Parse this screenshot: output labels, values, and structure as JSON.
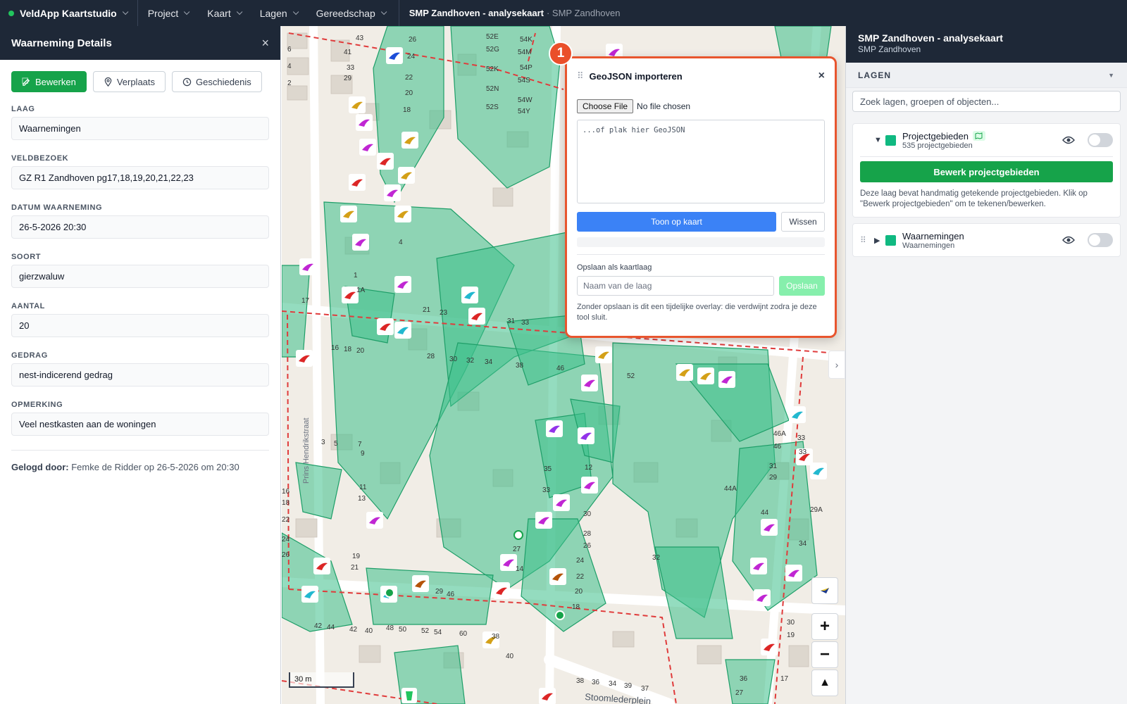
{
  "topbar": {
    "brand": "VeldApp Kaartstudio",
    "menu": [
      "Project",
      "Kaart",
      "Lagen",
      "Gereedschap"
    ],
    "breadcrumb_title": "SMP Zandhoven - analysekaart",
    "breadcrumb_sub": "· SMP Zandhoven"
  },
  "left": {
    "title": "Waarneming Details",
    "close": "×",
    "buttons": {
      "edit": "Bewerken",
      "move": "Verplaats",
      "history": "Geschiedenis"
    },
    "fields": [
      {
        "label": "LAAG",
        "value": "Waarnemingen"
      },
      {
        "label": "VELDBEZOEK",
        "value": "GZ R1 Zandhoven pg17,18,19,20,21,22,23"
      },
      {
        "label": "DATUM WAARNEMING",
        "value": "26-5-2026 20:30"
      },
      {
        "label": "SOORT",
        "value": "gierzwaluw"
      },
      {
        "label": "AANTAL",
        "value": "20"
      },
      {
        "label": "GEDRAG",
        "value": "nest-indicerend gedrag"
      },
      {
        "label": "OPMERKING",
        "value": "Veel nestkasten aan de woningen"
      }
    ],
    "logged_label": "Gelogd door:",
    "logged_value": "Femke de Ridder op 26-5-2026 om 20:30"
  },
  "dialog": {
    "badge": "1",
    "title": "GeoJSON importeren",
    "close": "×",
    "choose_file": "Choose File",
    "no_file": "No file chosen",
    "textarea_placeholder": "...of plak hier GeoJSON",
    "show_btn": "Toon op kaart",
    "clear_btn": "Wissen",
    "save_label": "Opslaan als kaartlaag",
    "layer_name_placeholder": "Naam van de laag",
    "save_btn": "Opslaan",
    "note": "Zonder opslaan is dit een tijdelijke overlay: die verdwijnt zodra je deze tool sluit."
  },
  "map": {
    "scale": "30 m",
    "street_1": "Prins Hendrikstraat",
    "street_2": "Stoomlederplein",
    "house_numbers": [
      "43",
      "26",
      "52E",
      "54K",
      "6",
      "41",
      "24",
      "52G",
      "54M",
      "4",
      "33",
      "52K",
      "54P",
      "2",
      "29",
      "22",
      "54S",
      "20",
      "52N",
      "52S",
      "54W",
      "54Y",
      "18",
      "1A",
      "17",
      "21",
      "23",
      "31",
      "33",
      "16",
      "18",
      "20",
      "28",
      "30",
      "32",
      "34",
      "38",
      "46",
      "52",
      "4",
      "1",
      "3",
      "5",
      "7",
      "9",
      "11",
      "13",
      "19",
      "21",
      "35",
      "33",
      "30",
      "28",
      "26",
      "24",
      "22",
      "20",
      "18",
      "27",
      "29",
      "46",
      "48",
      "50",
      "52",
      "54",
      "60",
      "38",
      "40",
      "42",
      "44",
      "42",
      "40",
      "38",
      "36",
      "34",
      "39",
      "37",
      "46A",
      "46",
      "33",
      "33",
      "31",
      "29",
      "44A",
      "44",
      "29A",
      "34",
      "32",
      "30",
      "19",
      "17",
      "36",
      "27",
      "12",
      "14",
      "16",
      "18",
      "22",
      "24",
      "26"
    ],
    "controls": {
      "zoom_in": "+",
      "zoom_out": "−",
      "north": "▲",
      "collapse": "›"
    },
    "colors": {
      "polygon_fill": "#3cc08a",
      "polygon_stroke": "#1e9e68",
      "boundary": "#e03b3b",
      "building": "#ddd7ce",
      "road": "#ffffff"
    }
  },
  "right": {
    "title": "SMP Zandhoven - analysekaart",
    "subtitle": "SMP Zandhoven",
    "section": "LAGEN",
    "section_arrow": "▼",
    "search_placeholder": "Zoek lagen, groepen of objecten...",
    "layers": [
      {
        "name": "Projectgebieden",
        "count": "535 projectgebieden",
        "button": "Bewerk projectgebieden",
        "desc": "Deze laag bevat handmatig getekende projectgebieden. Klik op \"Bewerk projectgebieden\" om te tekenen/bewerken."
      },
      {
        "name": "Waarnemingen",
        "count": "Waarnemingen"
      }
    ]
  }
}
